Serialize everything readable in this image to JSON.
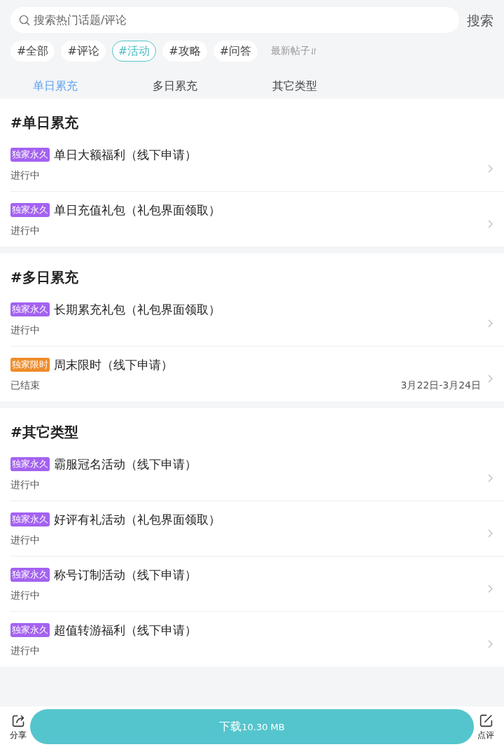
{
  "search": {
    "placeholder": "搜索热门话题/评论",
    "button": "搜索"
  },
  "topic_tags": [
    {
      "label": "#全部",
      "selected": false
    },
    {
      "label": "#评论",
      "selected": false
    },
    {
      "label": "#活动",
      "selected": true
    },
    {
      "label": "#攻略",
      "selected": false
    },
    {
      "label": "#问答",
      "selected": false
    }
  ],
  "sort": {
    "label": "最新帖子"
  },
  "tabs": [
    {
      "label": "单日累充",
      "selected": true
    },
    {
      "label": "多日累充",
      "selected": false
    },
    {
      "label": "其它类型",
      "selected": false
    }
  ],
  "sections": [
    {
      "title": "#单日累充",
      "items": [
        {
          "badge": "独家永久",
          "color": "#a462f0",
          "title": "单日大额福利（线下申请）",
          "status": "进行中"
        },
        {
          "badge": "独家永久",
          "color": "#a462f0",
          "title": "单日充值礼包（礼包界面领取）",
          "status": "进行中"
        }
      ]
    },
    {
      "title": "#多日累充",
      "items": [
        {
          "badge": "独家永久",
          "color": "#a462f0",
          "title": "长期累充礼包（礼包界面领取）",
          "status": "进行中"
        },
        {
          "badge": "独家限时",
          "color": "#ee8c2a",
          "title": "周末限时（线下申请）",
          "status": "已结束",
          "date": "3月22日-3月24日"
        }
      ]
    },
    {
      "title": "#其它类型",
      "items": [
        {
          "badge": "独家永久",
          "color": "#a462f0",
          "title": "霸服冠名活动（线下申请）",
          "status": "进行中"
        },
        {
          "badge": "独家永久",
          "color": "#a462f0",
          "title": "好评有礼活动（礼包界面领取）",
          "status": "进行中"
        },
        {
          "badge": "独家永久",
          "color": "#a462f0",
          "title": "称号订制活动（线下申请）",
          "status": "进行中"
        },
        {
          "badge": "独家永久",
          "color": "#a462f0",
          "title": "超值转游福利（线下申请）",
          "status": "进行中"
        }
      ]
    }
  ],
  "bottom_bar": {
    "share": "分享",
    "download": {
      "label": "下载",
      "size": "10.30 MB"
    },
    "review": "点评"
  }
}
